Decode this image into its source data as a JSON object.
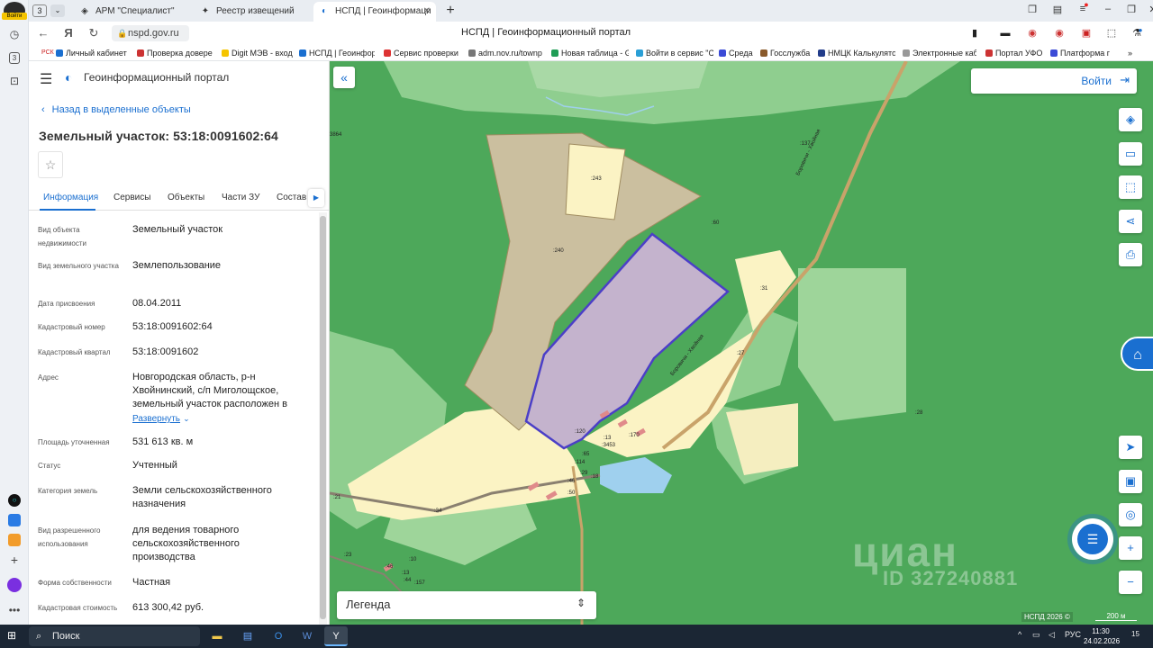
{
  "browser": {
    "tab_count": "3",
    "tabs": [
      {
        "label": "АРМ \"Специалист\"",
        "icon": "shield-icon"
      },
      {
        "label": "Реестр извещений",
        "icon": "emblem-icon"
      },
      {
        "label": "НСПД | Геоинформаци",
        "icon": "nspd-icon"
      }
    ],
    "url": "nspd.gov.ru",
    "page_title": "НСПД | Геоинформационный портал",
    "login_badge": "Войти",
    "bookmarks": [
      "Личный кабинет",
      "Проверка довере",
      "Digit МЭВ - вход",
      "НСПД | Геоинфор",
      "Сервис проверки",
      "adm.nov.ru/townp",
      "Новая таблица - G",
      "Войти в сервис \"С",
      "Среда",
      "Госслужба",
      "НМЦК Калькулято",
      "Электронные каб",
      "Портал УФО",
      "Платформа г"
    ]
  },
  "portal": {
    "title": "Геоинформационный портал"
  },
  "panel": {
    "back_label": "Назад в выделенные объекты",
    "object_title": "Земельный участок: 53:18:0091602:64",
    "tabs": [
      "Информация",
      "Сервисы",
      "Объекты",
      "Части ЗУ",
      "Состав"
    ],
    "expand_label": "Развернуть",
    "fields": [
      {
        "label": "Вид объекта недвижимости",
        "value": "Земельный участок"
      },
      {
        "label": "Вид земельного участка",
        "value": "Землепользование"
      },
      {
        "label": "Дата присвоения",
        "value": "08.04.2011"
      },
      {
        "label": "Кадастровый номер",
        "value": "53:18:0091602:64"
      },
      {
        "label": "Кадастровый квартал",
        "value": "53:18:0091602"
      },
      {
        "label": "Адрес",
        "value": "Новгородская область, р-н Хвойнинский, с/п Миголощское, земельный участок расположен в"
      },
      {
        "label": "Площадь уточненная",
        "value": "531 613 кв. м"
      },
      {
        "label": "Статус",
        "value": "Учтенный"
      },
      {
        "label": "Категория земель",
        "value": "Земли сельскохозяйственного назначения"
      },
      {
        "label": "Вид разрешенного использования",
        "value": "для ведения товарного сельскохозяйственного производства"
      },
      {
        "label": "Форма собственности",
        "value": "Частная"
      },
      {
        "label": "Кадастровая стоимость",
        "value": "613 300,42 руб."
      }
    ]
  },
  "map": {
    "login_label": "Войти",
    "legend_label": "Легенда",
    "watermark": "циан",
    "watermark_id": "ID 327240881",
    "copyright": "НСПД 2026 ©",
    "scale": "200 м",
    "labels": [
      ":243",
      ":240",
      ":60",
      ":137",
      ":31",
      ":27",
      ":28",
      ":120",
      ":13",
      ":3453",
      ":170",
      ":65",
      ":114",
      ":29",
      ":18",
      ":46",
      ":50",
      ":34",
      ":21",
      ":23",
      ":10",
      ":13",
      ":44",
      ":157",
      ":46",
      "3864"
    ],
    "road_labels": [
      "Боровичи - Хвойная",
      "Боровичи - Хвойная"
    ],
    "colors": {
      "forest": "#4da85a",
      "light_forest": "#8fce8f",
      "parcel_brown": "#cbbf9f",
      "parcel_yellow": "#fbf3c4",
      "selected_fill": "#c4b3cd",
      "selected_stroke": "#4b3fc7",
      "road": "#c9a36a"
    }
  },
  "taskbar": {
    "search_label": "Поиск",
    "lang": "РУС",
    "time": "11:30",
    "date": "24.02.2026",
    "notif": "15"
  }
}
